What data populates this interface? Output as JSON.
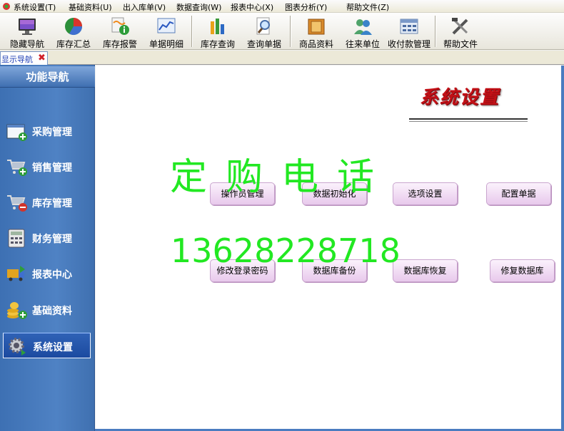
{
  "menubar": {
    "items": [
      "系统设置(T)",
      "基础资料(U)",
      "出入库单(V)",
      "数据查询(W)",
      "报表中心(X)",
      "图表分析(Y)",
      "帮助文件(Z)"
    ]
  },
  "toolbar": {
    "buttons": [
      {
        "label": "隐藏导航",
        "icon": "monitor-icon"
      },
      {
        "label": "库存汇总",
        "icon": "pie-chart-icon"
      },
      {
        "label": "库存报警",
        "icon": "alert-icon"
      },
      {
        "label": "单据明细",
        "icon": "line-chart-icon"
      },
      {
        "label": "库存查询",
        "icon": "bar-chart-icon"
      },
      {
        "label": "查询单据",
        "icon": "magnifier-icon"
      },
      {
        "label": "商品资料",
        "icon": "box-icon"
      },
      {
        "label": "往来单位",
        "icon": "users-icon"
      },
      {
        "label": "收付款管理",
        "icon": "calculator-icon"
      },
      {
        "label": "帮助文件",
        "icon": "tools-icon"
      }
    ]
  },
  "tabbar": {
    "tab_label": "显示导航",
    "close_glyph": "✖"
  },
  "sidebar": {
    "title": "功能导航",
    "items": [
      {
        "label": "采购管理",
        "icon": "purchase-icon"
      },
      {
        "label": "销售管理",
        "icon": "cart-add-icon"
      },
      {
        "label": "库存管理",
        "icon": "cart-remove-icon"
      },
      {
        "label": "财务管理",
        "icon": "finance-calculator-icon"
      },
      {
        "label": "报表中心",
        "icon": "report-truck-icon"
      },
      {
        "label": "基础资料",
        "icon": "coins-icon"
      },
      {
        "label": "系统设置",
        "icon": "settings-gear-icon",
        "active": true
      }
    ]
  },
  "main": {
    "title": "系统设置",
    "buttons_row1": [
      "操作员管理",
      "数据初始化",
      "选项设置",
      "配置单据"
    ],
    "buttons_row2": [
      "修改登录密码",
      "数据库备份",
      "数据库恢复",
      "修复数据库"
    ]
  },
  "overlay": {
    "line1": "定购电话",
    "line2": "13628228718"
  },
  "colors": {
    "sidebar": "#4a7cc0",
    "title_red": "#c21016",
    "overlay_green": "#22e822",
    "button_pink": "#e8c9ec"
  }
}
